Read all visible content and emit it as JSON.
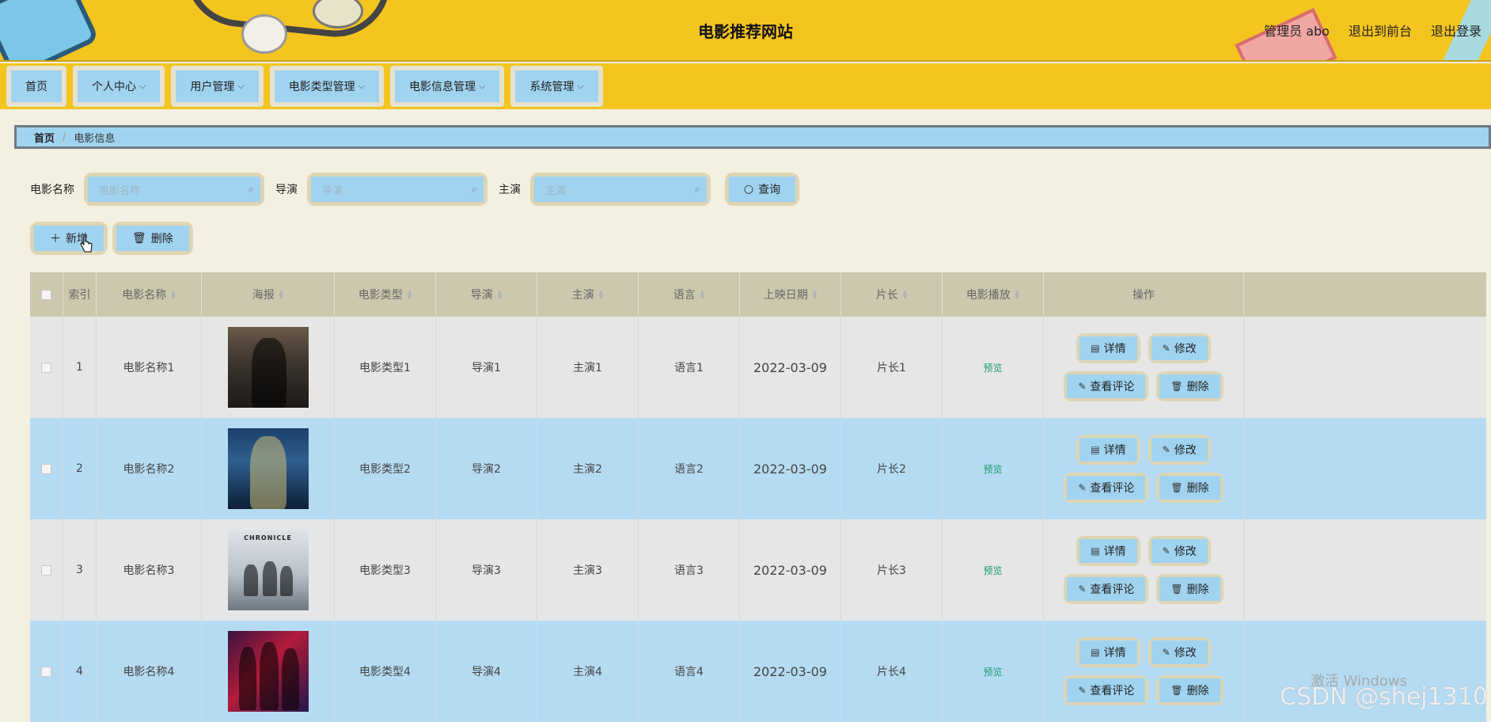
{
  "header": {
    "title": "电影推荐网站",
    "admin": "管理员 abo",
    "to_front": "退出到前台",
    "logout": "退出登录"
  },
  "nav": [
    "首页",
    "个人中心",
    "用户管理",
    "电影类型管理",
    "电影信息管理",
    "系统管理"
  ],
  "breadcrumb": {
    "home": "首页",
    "current": "电影信息"
  },
  "search": {
    "name_label": "电影名称",
    "name_placeholder": "电影名称",
    "director_label": "导演",
    "director_placeholder": "导演",
    "actor_label": "主演",
    "actor_placeholder": "主演",
    "query_btn": "查询"
  },
  "actions": {
    "add": "新增",
    "delete": "删除"
  },
  "columns": [
    "索引",
    "电影名称",
    "海报",
    "电影类型",
    "导演",
    "主演",
    "语言",
    "上映日期",
    "片长",
    "电影播放",
    "操作"
  ],
  "rows": [
    {
      "index": "1",
      "name": "电影名称1",
      "type": "电影类型1",
      "director": "导演1",
      "actor": "主演1",
      "language": "语言1",
      "date": "2022-03-09",
      "length": "片长1",
      "play": "预览"
    },
    {
      "index": "2",
      "name": "电影名称2",
      "type": "电影类型2",
      "director": "导演2",
      "actor": "主演2",
      "language": "语言2",
      "date": "2022-03-09",
      "length": "片长2",
      "play": "预览"
    },
    {
      "index": "3",
      "name": "电影名称3",
      "type": "电影类型3",
      "director": "导演3",
      "actor": "主演3",
      "language": "语言3",
      "date": "2022-03-09",
      "length": "片长3",
      "play": "预览"
    },
    {
      "index": "4",
      "name": "电影名称4",
      "type": "电影类型4",
      "director": "导演4",
      "actor": "主演4",
      "language": "语言4",
      "date": "2022-03-09",
      "length": "片长4",
      "play": "预览"
    }
  ],
  "posters": [
    "",
    "",
    "CHRONICLE",
    ""
  ],
  "row_ops": {
    "detail": "详情",
    "edit": "修改",
    "comments": "查看评论",
    "delete": "删除"
  },
  "overlay": {
    "windows": "激活 Windows",
    "watermark": "CSDN @shej1310"
  },
  "colors": {
    "header_bg": "#f4c41f",
    "button_bg": "#a0d3f0",
    "button_border": "#ddd5b4",
    "page_bg": "#f3f0e2",
    "table_head": "#ccc8ae",
    "row_even": "#e6e6e6",
    "row_odd": "#b5dbf2"
  }
}
